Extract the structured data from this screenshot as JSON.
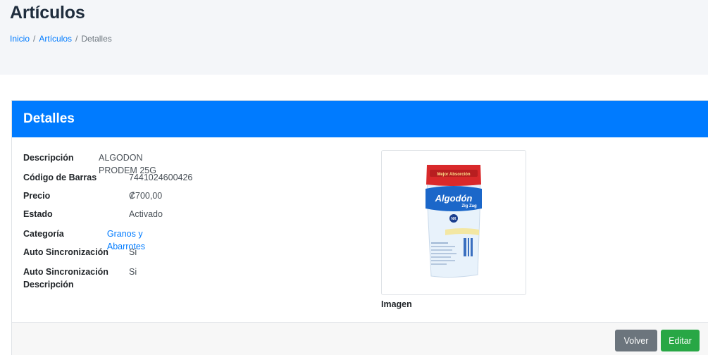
{
  "header": {
    "title": "Artículos",
    "breadcrumb": {
      "home": "Inicio",
      "section": "Artículos",
      "current": "Detalles",
      "separator": "/"
    }
  },
  "card": {
    "title": "Detalles",
    "fields": [
      {
        "label": "Descripción",
        "value": "ALGODON PRODEM 25G"
      },
      {
        "label": "Código de Barras",
        "value": "7441024600426"
      },
      {
        "label": "Precio",
        "value": "₡700,00"
      },
      {
        "label": "Estado",
        "value": "Activado"
      },
      {
        "label": "Categoría",
        "value": "Granos y Abarrotes"
      },
      {
        "label": "Auto Sincronización",
        "value": "Si"
      },
      {
        "label_line1": "Auto Sincronización",
        "label_line2": "Descripción",
        "value": "Si"
      }
    ],
    "image_caption": "Imagen",
    "product_image": {
      "brand": "Algodón",
      "subtitle": "Zig Zag",
      "top_label": "Mejor Absorción",
      "badge": "NX"
    },
    "buttons": {
      "back": "Volver",
      "edit": "Editar"
    }
  },
  "colors": {
    "primary": "#007bff",
    "secondary": "#6c757d",
    "success": "#28a745",
    "header_bg": "#f4f6f9"
  }
}
